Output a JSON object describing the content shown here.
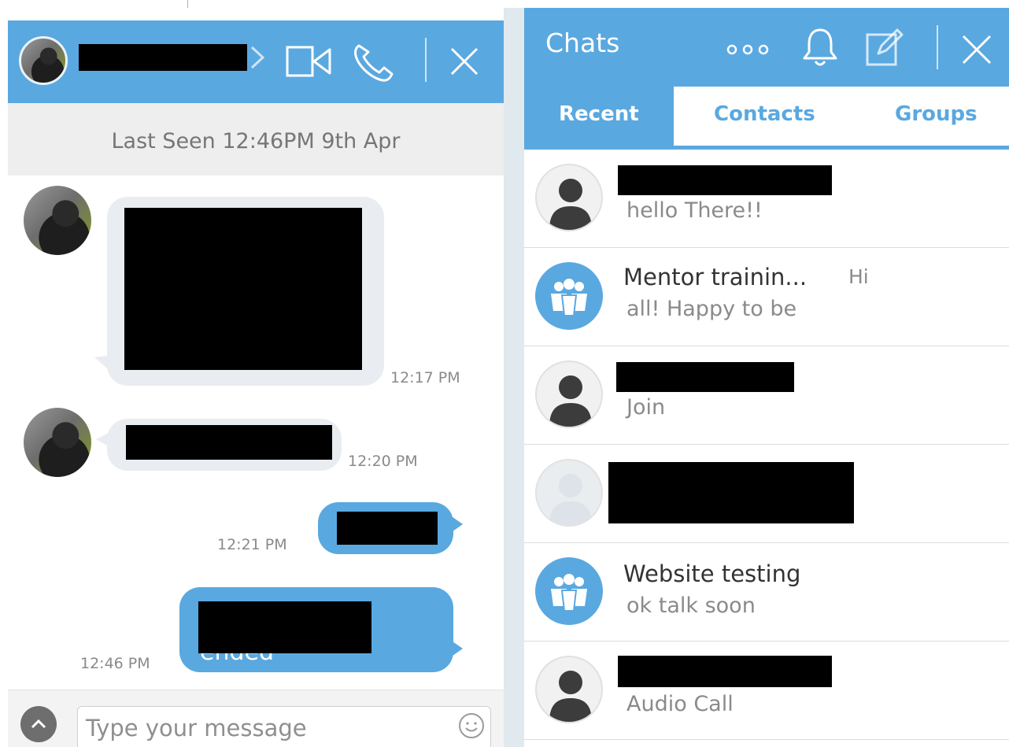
{
  "chat": {
    "last_seen": "Last Seen 12:46PM 9th Apr",
    "messages": [
      {
        "direction": "incoming",
        "time": "12:17 PM"
      },
      {
        "direction": "incoming",
        "time": "12:20 PM"
      },
      {
        "direction": "outgoing",
        "time": "12:21 PM"
      },
      {
        "direction": "outgoing",
        "time": "12:46 PM",
        "visible_text": "ended"
      }
    ],
    "composer": {
      "placeholder": "Type your message"
    }
  },
  "panel": {
    "title": "Chats",
    "tabs": [
      {
        "label": "Recent",
        "active": true
      },
      {
        "label": "Contacts",
        "active": false
      },
      {
        "label": "Groups",
        "active": false
      }
    ],
    "conversations": [
      {
        "avatar": "person-avatar",
        "name": "",
        "preview": "hello There!!"
      },
      {
        "avatar": "group-avatar",
        "name": "Mentor trainin...",
        "name_suffix": "Hi",
        "preview": "all! Happy to be"
      },
      {
        "avatar": "person-avatar",
        "name": "",
        "preview": "Join"
      },
      {
        "avatar": "blank-avatar",
        "name": "",
        "preview": ""
      },
      {
        "avatar": "group-avatar",
        "name": "Website testing",
        "preview": "ok talk soon"
      },
      {
        "avatar": "person-avatar",
        "name": "",
        "preview": "Audio Call"
      }
    ]
  },
  "colors": {
    "accent": "#5aa8e0",
    "bubble_in": "#e9ecf0",
    "header_text": "#ffffff",
    "muted_text": "#8a8a8a"
  },
  "icons": {
    "chat_header": [
      "chevron-right-icon",
      "video-camera-icon",
      "phone-icon",
      "close-icon"
    ],
    "panel_header": [
      "more-dots-icon",
      "bell-icon",
      "compose-icon",
      "close-icon"
    ],
    "composer": [
      "chevron-up-icon",
      "smiley-icon"
    ]
  }
}
